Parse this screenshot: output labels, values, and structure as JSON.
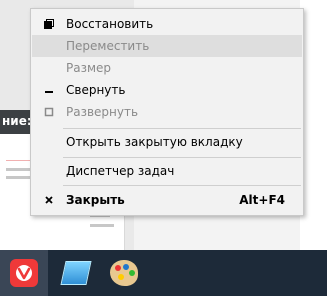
{
  "background": {
    "window_title": "ние: р"
  },
  "menu": {
    "restore": "Восстановить",
    "move": "Переместить",
    "size": "Размер",
    "minimize": "Свернуть",
    "maximize": "Развернуть",
    "reopen_tab": "Открыть закрытую вкладку",
    "task_manager": "Диспетчер задач",
    "close": "Закрыть",
    "close_shortcut": "Alt+F4"
  },
  "taskbar": {
    "apps": [
      "vivaldi-icon",
      "notes-icon",
      "paint-icon"
    ]
  },
  "colors": {
    "taskbar": "#1d2a39",
    "menu_bg": "#f2f2f2",
    "vivaldi": "#ef3939"
  }
}
